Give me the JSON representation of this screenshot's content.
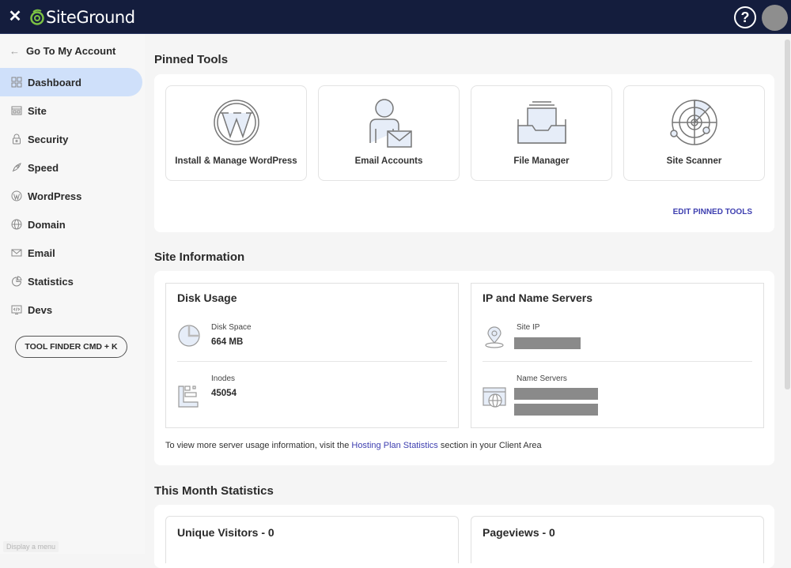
{
  "topbar": {
    "close_icon": "close-icon",
    "brand": "SiteGround",
    "help_label": "?",
    "avatar_color": "#8e8e8e",
    "bg_color": "#141d3d"
  },
  "sidebar": {
    "back_label": "Go To My Account",
    "items": [
      {
        "label": "Dashboard",
        "icon": "grid-icon",
        "active": true
      },
      {
        "label": "Site",
        "icon": "site-icon"
      },
      {
        "label": "Security",
        "icon": "lock-icon"
      },
      {
        "label": "Speed",
        "icon": "rocket-icon"
      },
      {
        "label": "WordPress",
        "icon": "wordpress-icon"
      },
      {
        "label": "Domain",
        "icon": "globe-icon"
      },
      {
        "label": "Email",
        "icon": "envelope-icon"
      },
      {
        "label": "Statistics",
        "icon": "pie-chart-icon"
      },
      {
        "label": "Devs",
        "icon": "code-icon"
      }
    ],
    "tool_finder_label": "TOOL FINDER CMD + K",
    "tooltip": "Display a menu"
  },
  "pinned_tools": {
    "title": "Pinned Tools",
    "tools": [
      {
        "label": "Install & Manage WordPress",
        "icon": "wordpress-icon"
      },
      {
        "label": "Email Accounts",
        "icon": "email-accounts-icon"
      },
      {
        "label": "File Manager",
        "icon": "file-manager-icon"
      },
      {
        "label": "Site Scanner",
        "icon": "radar-icon"
      }
    ],
    "edit_label": "EDIT PINNED TOOLS",
    "accent_color": "#3e3fb0"
  },
  "site_information": {
    "title": "Site Information",
    "disk_usage": {
      "title": "Disk Usage",
      "disk_space_label": "Disk Space",
      "disk_space_value": "664 MB",
      "inodes_label": "Inodes",
      "inodes_value": "45054"
    },
    "ip_servers": {
      "title": "IP and Name Servers",
      "site_ip_label": "Site IP",
      "name_servers_label": "Name Servers"
    },
    "footnote_before": "To view more server usage information, visit the ",
    "footnote_link": "Hosting Plan Statistics",
    "footnote_after": " section in your Client Area"
  },
  "month_stats": {
    "title": "This Month Statistics",
    "unique_visitors": "Unique Visitors - 0",
    "pageviews": "Pageviews - 0"
  }
}
